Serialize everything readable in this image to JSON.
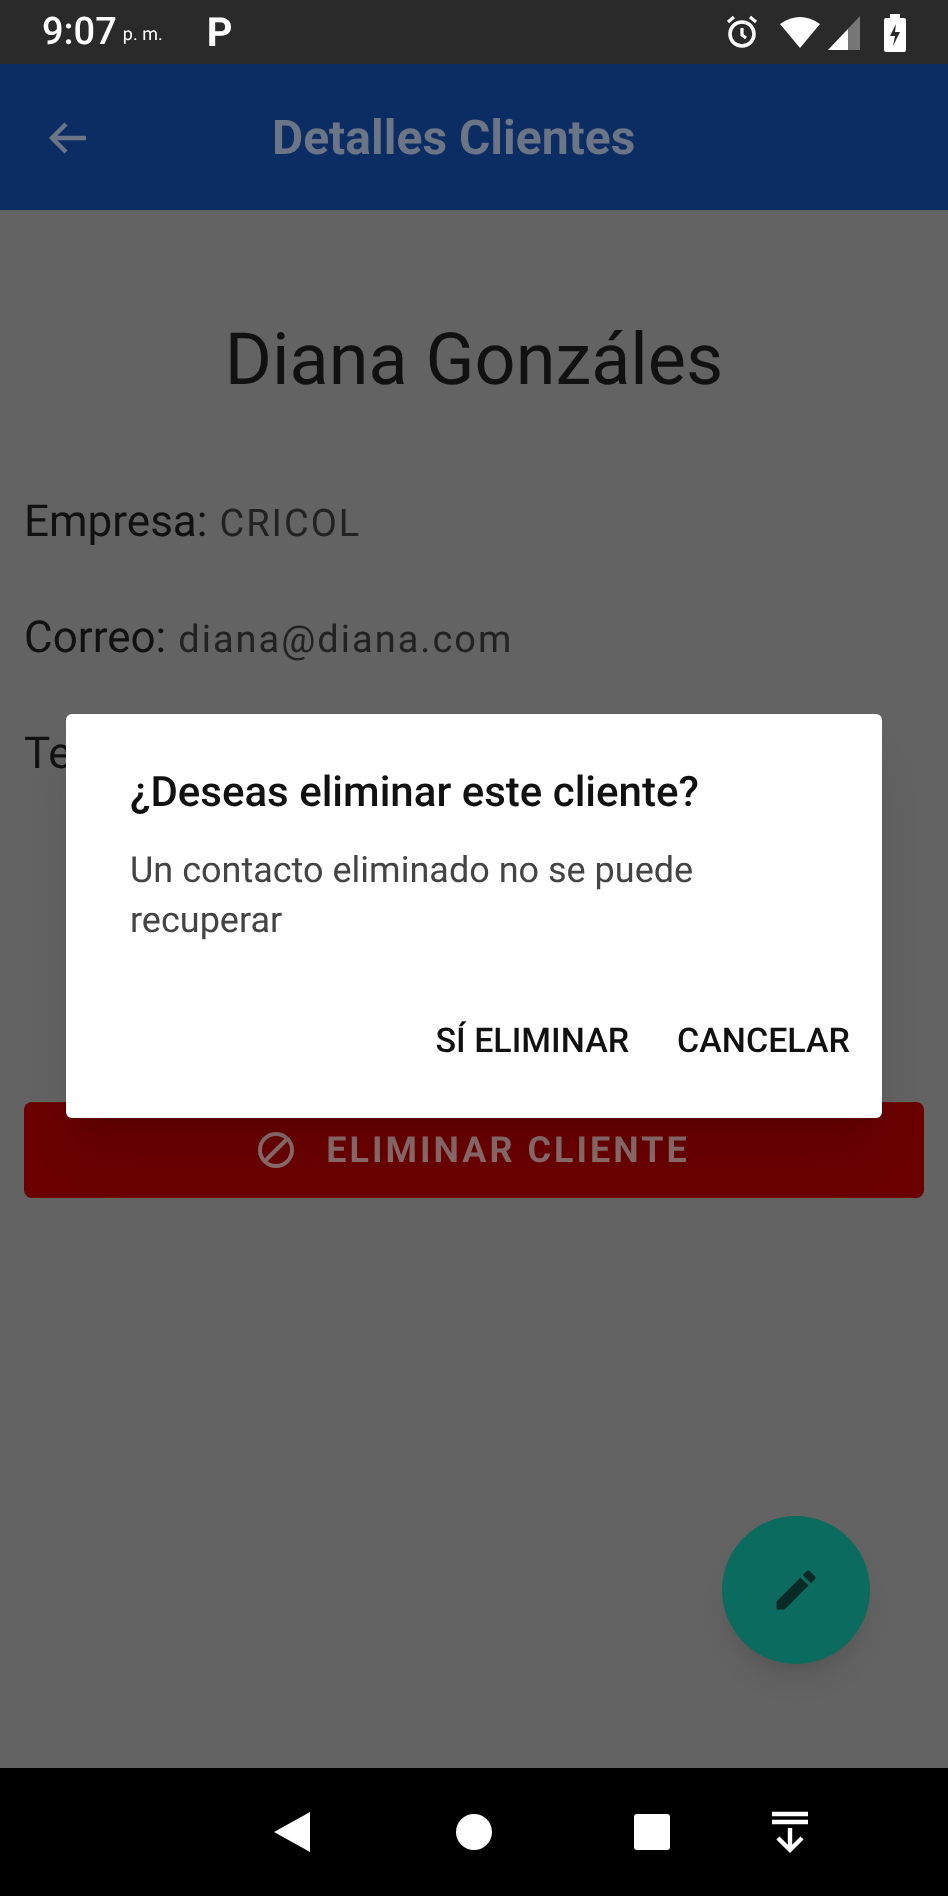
{
  "status_bar": {
    "time": "9:07",
    "ampm": "p. m.",
    "app_badge": "P"
  },
  "app_bar": {
    "title": "Detalles Clientes"
  },
  "client": {
    "name": "Diana Gonzáles",
    "fields": [
      {
        "label": "Empresa:",
        "value": "CRICOL"
      },
      {
        "label": "Correo:",
        "value": "diana@diana.com"
      },
      {
        "label": "Te"
      }
    ]
  },
  "delete_button": {
    "label": "ELIMINAR CLIENTE"
  },
  "dialog": {
    "title": "¿Deseas eliminar este cliente?",
    "message": "Un contacto eliminado no se puede recuperar",
    "actions": [
      "SÍ ELIMINAR",
      "CANCELAR"
    ]
  }
}
